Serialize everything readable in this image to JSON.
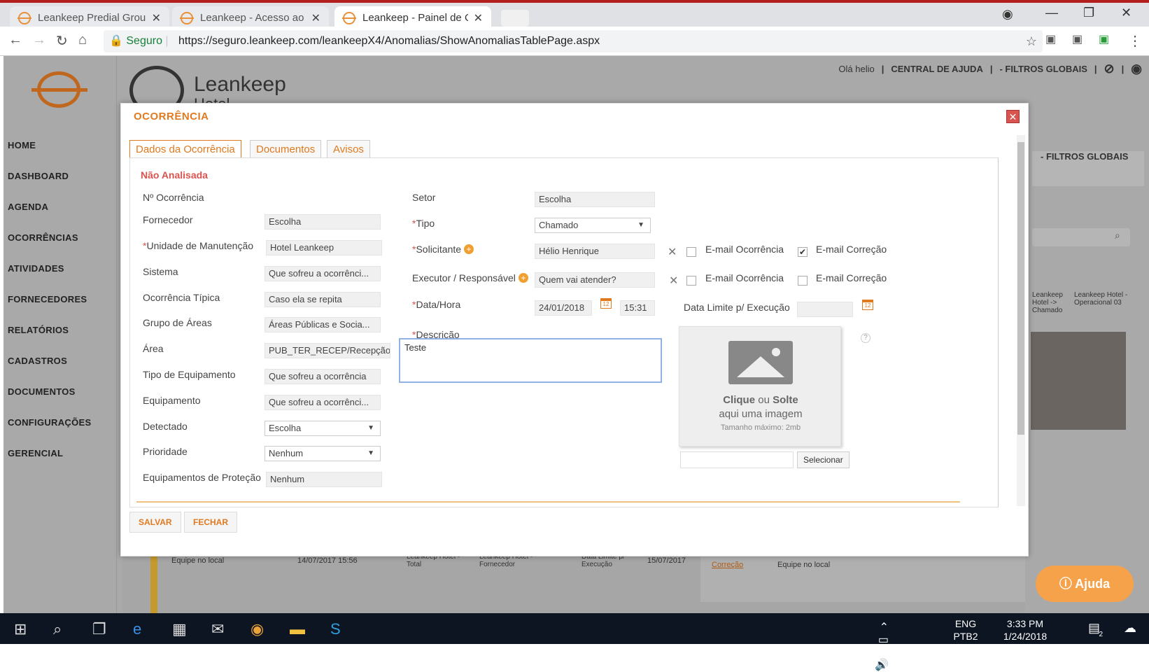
{
  "browser": {
    "tabs": [
      {
        "title": "Leankeep Predial Group"
      },
      {
        "title": "Leankeep - Acesso ao Si"
      },
      {
        "title": "Leankeep - Painel de Oc"
      }
    ],
    "secure_label": "Seguro",
    "url": "https://seguro.leankeep.com/leankeepX4/Anomalias/ShowAnomaliasTablePage.aspx"
  },
  "app": {
    "brand": "Leankeep",
    "brand_sub": "Hotel",
    "greeting": "Olá helio",
    "help_center": "CENTRAL DE AJUDA",
    "global_filters": "- FILTROS GLOBAIS",
    "global_filters_2": "- FILTROS GLOBAIS",
    "sidebar": [
      "HOME",
      "DASHBOARD",
      "AGENDA",
      "OCORRÊNCIAS",
      "ATIVIDADES",
      "FORNECEDORES",
      "RELATÓRIOS",
      "CADASTROS",
      "DOCUMENTOS",
      "CONFIGURAÇÕES",
      "GERENCIAL"
    ],
    "help_button": "Ajuda"
  },
  "modal": {
    "title": "OCORRÊNCIA",
    "tabs": [
      "Dados da Ocorrência",
      "Documentos",
      "Avisos"
    ],
    "status": "Não Analisada",
    "left_fields": [
      {
        "label": "Nº Ocorrência",
        "value": ""
      },
      {
        "label": "Fornecedor",
        "value": "Escolha"
      },
      {
        "label": "Unidade de Manutenção",
        "value": "Hotel Leankeep"
      },
      {
        "label": "Sistema",
        "value": "Que sofreu a ocorrênci..."
      },
      {
        "label": "Ocorrência Típica",
        "value": "Caso ela se repita"
      },
      {
        "label": "Grupo de Áreas",
        "value": "Áreas Públicas e Socia..."
      },
      {
        "label": "Área",
        "value": "PUB_TER_RECEP/Recepção"
      },
      {
        "label": "Tipo de Equipamento",
        "value": "Que sofreu a ocorrência"
      },
      {
        "label": "Equipamento",
        "value": "Que sofreu a ocorrênci..."
      },
      {
        "label": "Detectado",
        "value": "Escolha"
      },
      {
        "label": "Prioridade",
        "value": "Nenhum"
      },
      {
        "label": "Equipamentos de Proteção",
        "value": "Nenhum"
      }
    ],
    "setor": {
      "label": "Setor",
      "value": "Escolha"
    },
    "tipo": {
      "label": "Tipo",
      "value": "Chamado"
    },
    "solicitante": {
      "label": "Solicitante",
      "value": "Hélio Henrique"
    },
    "executor": {
      "label": "Executor / Responsável",
      "placeholder": "Quem vai atender?"
    },
    "email_ocorrencia": "E-mail Ocorrência",
    "email_correcao": "E-mail Correção",
    "data_hora": {
      "label": "Data/Hora",
      "date": "24/01/2018",
      "time": "15:31"
    },
    "data_limite": {
      "label": "Data Limite p/ Execução",
      "value": ""
    },
    "descricao": {
      "label": "Descrição",
      "value": "Teste"
    },
    "upload": {
      "click": "Clique",
      "or": "ou",
      "drop": "Solte",
      "line2": "aqui uma imagem",
      "max": "Tamanho máximo: 2mb",
      "select_button": "Selecionar",
      "help": "?"
    },
    "save_button": "SALVAR",
    "close_button": "FECHAR"
  },
  "background_row": {
    "team": "Equipe no local",
    "date1": "14/07/2017 15:56",
    "path1": "Leankeep Hotel - Total",
    "path2": "Leankeep Hotel - Fornecedor",
    "limit": "Data Limite p/ Execução",
    "date2": "15/07/2017",
    "correction": "Correção",
    "team2": "Equipe no local",
    "card1": "Leankeep Hotel -> Chamado",
    "card2": "Leankeep Hotel - Operacional 03"
  },
  "taskbar": {
    "lang": "ENG",
    "layout": "PTB2",
    "time": "3:33 PM",
    "date": "1/24/2018",
    "notif": "2"
  }
}
